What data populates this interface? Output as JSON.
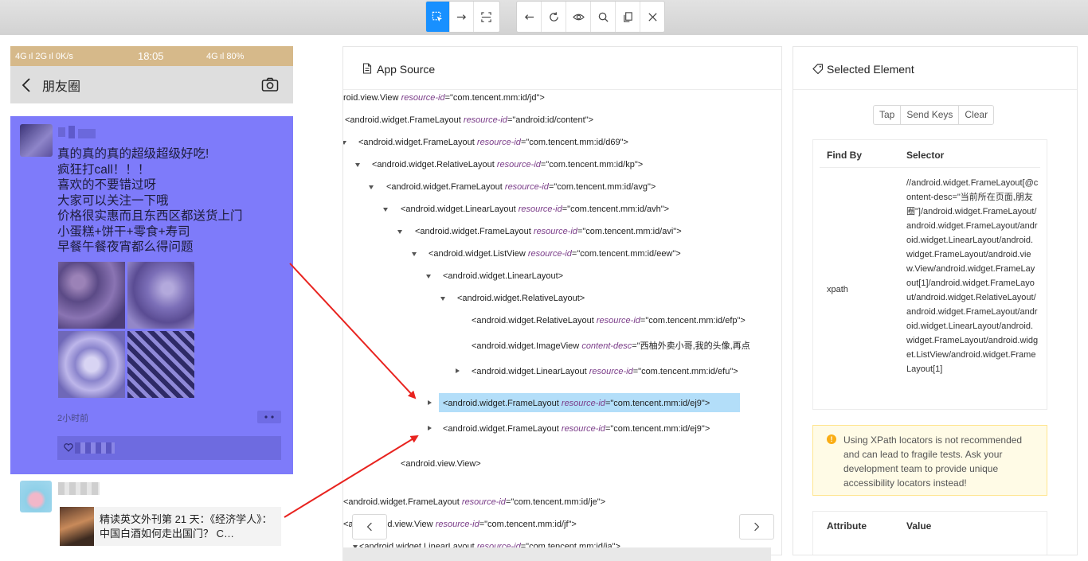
{
  "toolbar": {
    "mode_buttons": [
      "select-element",
      "swipe",
      "tap-by-coordinates"
    ],
    "action_buttons": [
      "back",
      "refresh",
      "show-hide",
      "search",
      "copy",
      "quit"
    ],
    "active_color": "#1890ff"
  },
  "phone": {
    "status": {
      "left": "4G ıl 2G ıl 0K/s",
      "time": "18:05",
      "right": "4G ıl 80%"
    },
    "nav": {
      "title": "朋友圈"
    },
    "post": {
      "lines": [
        "真的真的真的超级超级好吃!",
        "疯狂打call！！！",
        "喜欢的不要错过呀",
        "大家可以关注一下哦",
        "价格很实惠而且东西区都送货上门",
        "小蛋糕+饼干+零食+寿司",
        "早餐午餐夜宵都么得问题"
      ],
      "time_ago": "2小时前"
    },
    "post2": {
      "article": "精读英文外刊第 21 天：《经济学人》：中国白酒如何走出国门？ C…"
    },
    "highlight_color": "#7e7bfa"
  },
  "source": {
    "title": "App Source",
    "nodes": [
      {
        "tag": "roid.view.View",
        "attr": "resource-id",
        "val": "\"com.tencent.mm:id/jd\">"
      },
      {
        "tag": "<android.widget.FrameLayout",
        "attr": "resource-id",
        "val": "=\"android:id/content\">"
      },
      {
        "tag": "<android.widget.FrameLayout",
        "attr": "resource-id",
        "val": "=\"com.tencent.mm:id/d69\">"
      },
      {
        "tag": "<android.widget.RelativeLayout",
        "attr": "resource-id",
        "val": "=\"com.tencent.mm:id/kp\">"
      },
      {
        "tag": "<android.widget.FrameLayout",
        "attr": "resource-id",
        "val": "=\"com.tencent.mm:id/avg\">"
      },
      {
        "tag": "<android.widget.LinearLayout",
        "attr": "resource-id",
        "val": "=\"com.tencent.mm:id/avh\">"
      },
      {
        "tag": "<android.widget.FrameLayout",
        "attr": "resource-id",
        "val": "=\"com.tencent.mm:id/avi\">"
      },
      {
        "tag": "<android.widget.ListView",
        "attr": "resource-id",
        "val": "=\"com.tencent.mm:id/eew\">"
      },
      {
        "tag": "<android.widget.LinearLayout>",
        "attr": "",
        "val": ""
      },
      {
        "tag": "<android.widget.RelativeLayout>",
        "attr": "",
        "val": ""
      },
      {
        "tag": "<android.widget.RelativeLayout",
        "attr": "resource-id",
        "val": "=\"com.tencent.mm:id/efp\">"
      },
      {
        "tag": "<android.widget.ImageView",
        "attr": "content-desc",
        "val": "=\"西柚外卖小哥,我的头像,再点"
      },
      {
        "tag": "<android.widget.LinearLayout",
        "attr": "resource-id",
        "val": "=\"com.tencent.mm:id/efu\">"
      },
      {
        "tag": "<android.widget.FrameLayout",
        "attr": "resource-id",
        "val": "=\"com.tencent.mm:id/ej9\">"
      },
      {
        "tag": "<android.widget.FrameLayout",
        "attr": "resource-id",
        "val": "=\"com.tencent.mm:id/ej9\">"
      },
      {
        "tag": "<android.view.View>",
        "attr": "",
        "val": ""
      },
      {
        "tag": "<android.widget.FrameLayout",
        "attr": "resource-id",
        "val": "=\"com.tencent.mm:id/je\">"
      },
      {
        "tag": "<andr      oid.view.View",
        "attr": "resource-id",
        "val": "=\"com.tencent.mm:id/jf\">"
      },
      {
        "tag": "<android.widget.LinearLayout",
        "attr": "resource-id",
        "val": "=\"com.tencent.mm:id/ia\">"
      }
    ],
    "selected_index": 13
  },
  "element": {
    "title": "Selected Element",
    "actions": [
      "Tap",
      "Send Keys",
      "Clear"
    ],
    "find_by_header": "Find By",
    "selector_header": "Selector",
    "strategy": "xpath",
    "selector": "//android.widget.FrameLayout[@content-desc=\"当前所在页面,朋友圈\"]/android.widget.FrameLayout/android.widget.FrameLayout/android.widget.LinearLayout/android.widget.FrameLayout/android.view.View/android.widget.FrameLayout[1]/android.widget.FrameLayout/android.widget.RelativeLayout/android.widget.FrameLayout/android.widget.LinearLayout/android.widget.FrameLayout/android.widget.ListView/android.widget.FrameLayout[1]",
    "warning": "Using XPath locators is not recommended and can lead to fragile tests. Ask your development team to provide unique accessibility locators instead!",
    "attribute_header": "Attribute",
    "value_header": "Value",
    "warning_color": "#faad14"
  }
}
